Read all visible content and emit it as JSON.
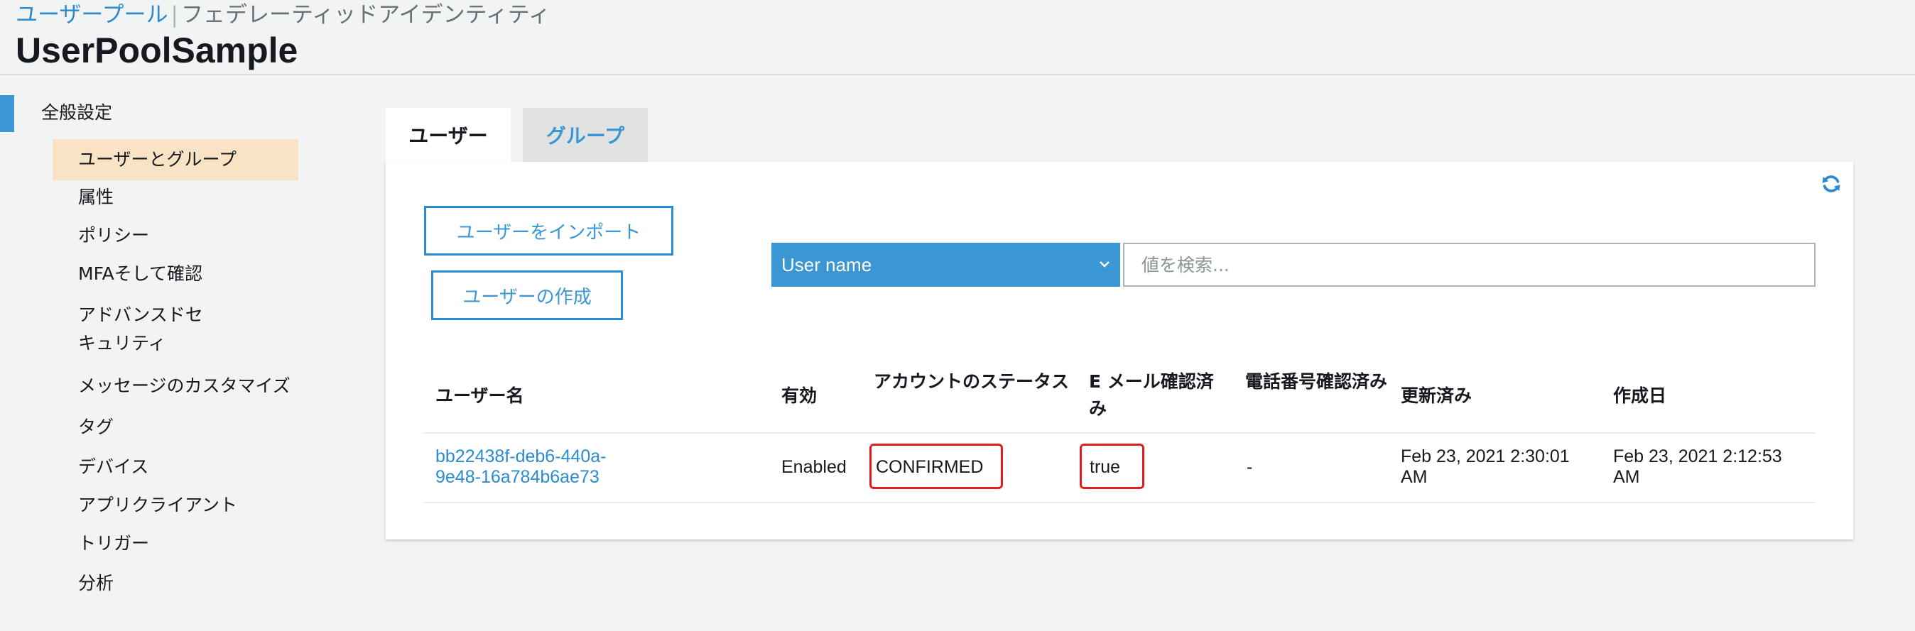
{
  "header": {
    "breadcrumb": {
      "user_pools": "ユーザープール",
      "federated_identities": "フェデレーティッドアイデンティティ"
    },
    "title": "UserPoolSample"
  },
  "sidebar": {
    "section_label": "全般設定",
    "items": [
      {
        "label": "ユーザーとグループ",
        "active": true
      },
      {
        "label": "属性"
      },
      {
        "label": "ポリシー"
      },
      {
        "label": "MFAそして確認"
      },
      {
        "label": "アドバンスドセキュリティ"
      },
      {
        "label": "メッセージのカスタマイズ"
      },
      {
        "label": "タグ"
      },
      {
        "label": "デバイス"
      },
      {
        "label": "アプリクライアント"
      },
      {
        "label": "トリガー"
      },
      {
        "label": "分析"
      }
    ]
  },
  "tabs": {
    "users": "ユーザー",
    "groups": "グループ"
  },
  "toolbar": {
    "import_users_label": "ユーザーをインポート",
    "create_user_label": "ユーザーの作成",
    "search_attribute": "User name",
    "search_placeholder": "値を検索..."
  },
  "table": {
    "columns": {
      "username": "ユーザー名",
      "enabled": "有効",
      "account_status": "アカウントのステータス",
      "email_verified": "E メール確認済み",
      "phone_verified": "電話番号確認済み",
      "updated": "更新済み",
      "created": "作成日"
    },
    "rows": [
      {
        "username": "bb22438f-deb6-440a-9e48-16a784b6ae73",
        "enabled": "Enabled",
        "account_status": "CONFIRMED",
        "email_verified": "true",
        "phone_verified": "-",
        "updated": "Feb 23, 2021 2:30:01 AM",
        "created": "Feb 23, 2021 2:12:53 AM"
      }
    ]
  },
  "colors": {
    "accent": "#3b97d3",
    "link": "#2a8bd0",
    "active_nav_bg": "#f8e3c5",
    "highlight_border": "#e01e1e"
  }
}
